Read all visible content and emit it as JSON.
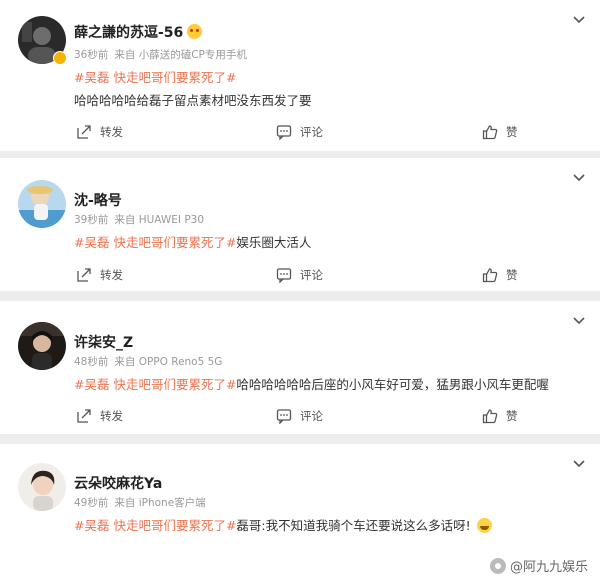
{
  "actions": {
    "repost": "转发",
    "comment": "评论",
    "like": "赞"
  },
  "posts": [
    {
      "name": "薛之謙的苏逗-56",
      "time": "36秒前",
      "source": "来自 小薛送的磕CP专用手机",
      "topic": "#吴磊 快走吧哥们要累死了#",
      "text_after_topic": "",
      "text_line": "哈哈哈哈哈给磊子留点素材吧没东西发了要"
    },
    {
      "name": "沈-略号",
      "time": "39秒前",
      "source": "来自 HUAWEI P30",
      "topic": "#吴磊 快走吧哥们要累死了#",
      "text_after_topic": "娱乐圈大活人"
    },
    {
      "name": "许柒安_Z",
      "time": "48秒前",
      "source": "来自 OPPO Reno5 5G",
      "topic": "#吴磊 快走吧哥们要累死了#",
      "text_after_topic": "哈哈哈哈哈哈后座的小风车好可爱，猛男跟小风车更配喔"
    },
    {
      "name": "云朵咬麻花Ya",
      "time": "49秒前",
      "source": "来自 iPhone客户端",
      "topic": "#吴磊 快走吧哥们要累死了#",
      "text_after_topic": "磊哥:我不知道我骑个车还要说这么多话呀!"
    }
  ],
  "watermark": "@阿九九娱乐",
  "icons": {
    "menu": "chevron-down-icon",
    "repost": "repost-icon",
    "comment": "comment-icon",
    "like": "thumbs-up-icon"
  },
  "colors": {
    "topic": "#eb7350",
    "meta": "#999999",
    "background": "#ececec",
    "verified": "#f7b500"
  }
}
